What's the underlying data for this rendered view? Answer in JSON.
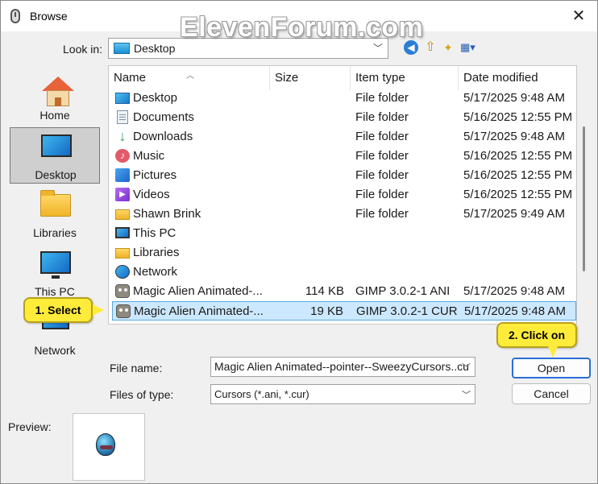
{
  "window": {
    "title": "Browse",
    "close_glyph": "✕"
  },
  "watermark": "ElevenForum.com",
  "lookin": {
    "label": "Look in:",
    "value": "Desktop"
  },
  "toolbar": {
    "back_icon": "back-icon",
    "up_icon": "up-folder-icon",
    "new_folder_icon": "new-folder-icon",
    "view_icon": "view-menu-icon"
  },
  "places": [
    {
      "label": "Home",
      "icon": "home-icon"
    },
    {
      "label": "Desktop",
      "icon": "desktop-icon",
      "selected": true
    },
    {
      "label": "Libraries",
      "icon": "libraries-icon"
    },
    {
      "label": "This PC",
      "icon": "this-pc-icon"
    },
    {
      "label": "Network",
      "icon": "network-icon"
    }
  ],
  "columns": {
    "name": "Name",
    "size": "Size",
    "type": "Item type",
    "date": "Date modified"
  },
  "rows": [
    {
      "name": "Desktop",
      "size": "",
      "type": "File folder",
      "date": "5/17/2025 9:48 AM",
      "icon": "desktop-icon"
    },
    {
      "name": "Documents",
      "size": "",
      "type": "File folder",
      "date": "5/16/2025 12:55 PM",
      "icon": "documents-icon"
    },
    {
      "name": "Downloads",
      "size": "",
      "type": "File folder",
      "date": "5/17/2025 9:48 AM",
      "icon": "downloads-icon"
    },
    {
      "name": "Music",
      "size": "",
      "type": "File folder",
      "date": "5/16/2025 12:55 PM",
      "icon": "music-icon"
    },
    {
      "name": "Pictures",
      "size": "",
      "type": "File folder",
      "date": "5/16/2025 12:55 PM",
      "icon": "pictures-icon"
    },
    {
      "name": "Videos",
      "size": "",
      "type": "File folder",
      "date": "5/16/2025 12:55 PM",
      "icon": "videos-icon"
    },
    {
      "name": "Shawn Brink",
      "size": "",
      "type": "File folder",
      "date": "5/17/2025 9:49 AM",
      "icon": "folder-icon"
    },
    {
      "name": "This PC",
      "size": "",
      "type": "",
      "date": "",
      "icon": "this-pc-icon"
    },
    {
      "name": "Libraries",
      "size": "",
      "type": "",
      "date": "",
      "icon": "libraries-icon"
    },
    {
      "name": "Network",
      "size": "",
      "type": "",
      "date": "",
      "icon": "network-icon"
    },
    {
      "name": "Magic Alien Animated-...",
      "size": "114 KB",
      "type": "GIMP 3.0.2-1 ANI",
      "date": "5/17/2025 9:48 AM",
      "icon": "gimp-file-icon"
    },
    {
      "name": "Magic Alien Animated-...",
      "size": "19 KB",
      "type": "GIMP 3.0.2-1 CUR",
      "date": "5/17/2025 9:48 AM",
      "icon": "gimp-file-icon",
      "selected": true
    }
  ],
  "filename": {
    "label": "File name:",
    "value": "Magic Alien Animated--pointer--SweezyCursors..cu"
  },
  "filetype": {
    "label": "Files of type:",
    "value": "Cursors (*.ani, *.cur)"
  },
  "buttons": {
    "open": "Open",
    "cancel": "Cancel"
  },
  "preview": {
    "label": "Preview:"
  },
  "callouts": {
    "select": "1. Select",
    "open": "2. Click on"
  },
  "colors": {
    "selection": "#cce8ff",
    "selection_border": "#5ba7e0",
    "callout": "#ffec3a",
    "open_border": "#2a6fd6"
  }
}
